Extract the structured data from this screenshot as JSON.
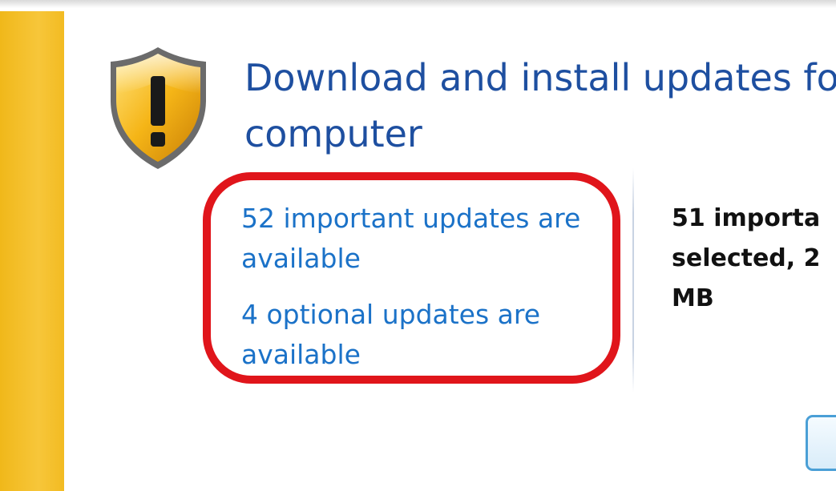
{
  "heading": {
    "line1": "Download and install updates fo",
    "line2": "computer"
  },
  "links": {
    "important_line1": "52 important updates are",
    "important_line2": "available",
    "optional_line1": "4 optional updates are",
    "optional_line2": "available"
  },
  "summary": {
    "line1": "51 importa",
    "line2": "selected, 2",
    "line3": "MB"
  },
  "icons": {
    "shield": "warning-shield-icon"
  },
  "colors": {
    "accent_bar": "#f2bb22",
    "heading_text": "#1e4fa0",
    "link_text": "#1b72c8",
    "highlight_ring": "#e0151b"
  }
}
